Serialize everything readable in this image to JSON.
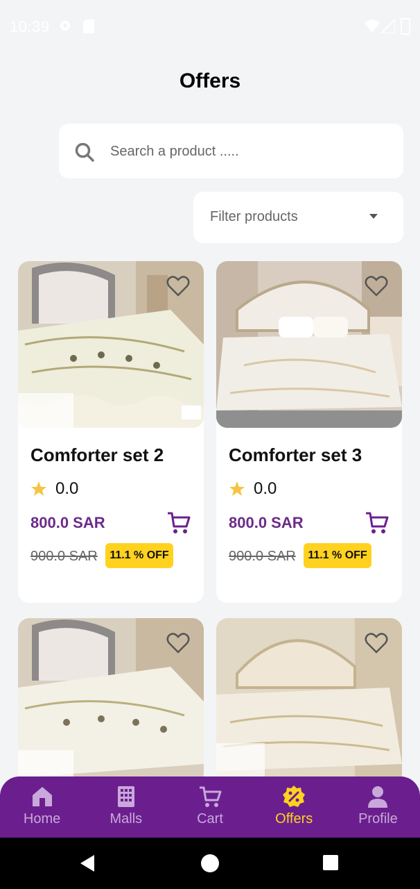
{
  "status_bar": {
    "time": "10:39"
  },
  "page": {
    "title": "Offers"
  },
  "search": {
    "placeholder": "Search a product ....."
  },
  "filter": {
    "label": "Filter products"
  },
  "products": [
    {
      "name": "Comforter set 2",
      "rating": "0.0",
      "price": "800.0 SAR",
      "old_price": "900.0 SAR",
      "discount": "11.1 % OFF",
      "image_alt": "bed comforter set 8pcs"
    },
    {
      "name": "Comforter set 3",
      "rating": "0.0",
      "price": "800.0 SAR",
      "old_price": "900.0 SAR",
      "discount": "11.1 % OFF",
      "image_alt": "bed comforter set"
    },
    {
      "image_alt": "bed comforter set 8pcs"
    },
    {
      "image_alt": "bed comforter set 8pcs"
    }
  ],
  "nav": {
    "items": [
      {
        "label": "Home",
        "icon": "home-icon"
      },
      {
        "label": "Malls",
        "icon": "building-icon"
      },
      {
        "label": "Cart",
        "icon": "cart-icon"
      },
      {
        "label": "Offers",
        "icon": "percent-badge-icon",
        "active": true
      },
      {
        "label": "Profile",
        "icon": "person-icon"
      }
    ]
  },
  "colors": {
    "brand": "#6b1f8e",
    "price": "#6b2a8a",
    "badge": "#ffd21f",
    "background": "#f3f4f6"
  }
}
